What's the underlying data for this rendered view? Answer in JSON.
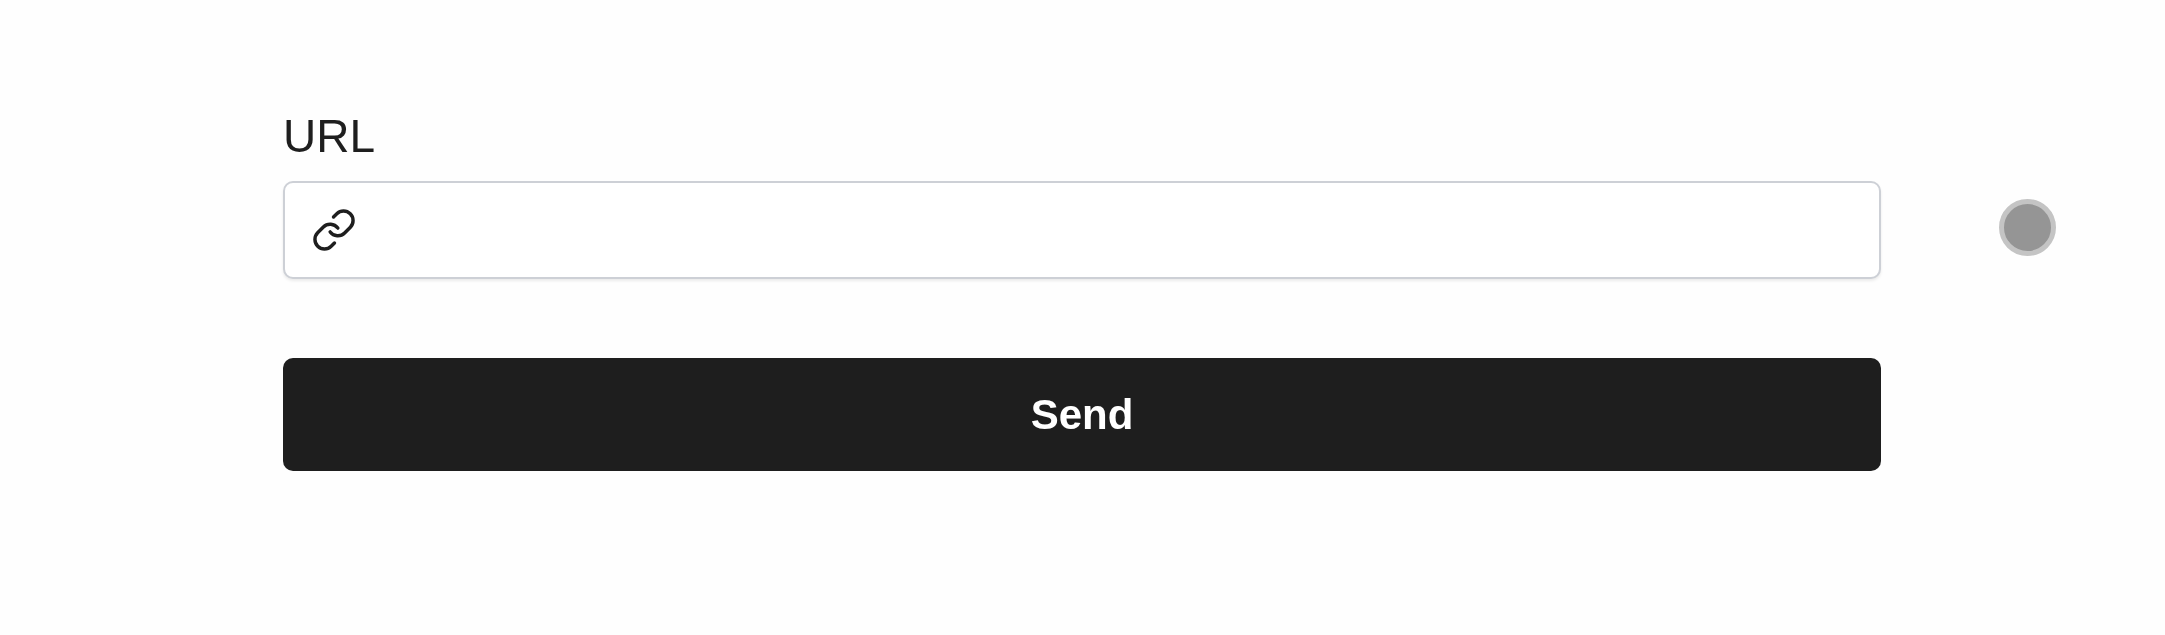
{
  "form": {
    "label": "URL",
    "button": "Send"
  }
}
